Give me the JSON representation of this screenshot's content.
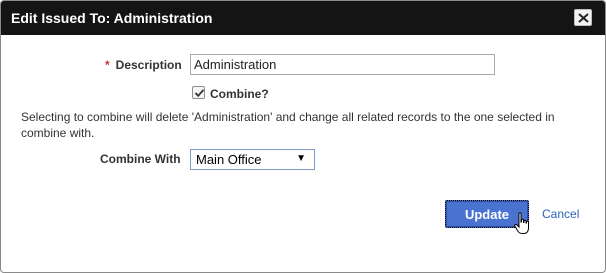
{
  "dialog": {
    "title": "Edit Issued To: Administration",
    "close_icon": "close-icon"
  },
  "form": {
    "description": {
      "required_marker": "*",
      "label": "Description",
      "value": "Administration"
    },
    "combine": {
      "label": "Combine?",
      "checked": true
    },
    "help_text": "Selecting to combine will delete 'Administration' and change all related records to the one selected in combine with.",
    "combine_with": {
      "label": "Combine With",
      "selected": "Main Office"
    }
  },
  "actions": {
    "update_label": "Update",
    "cancel_label": "Cancel"
  },
  "colors": {
    "titlebar": "#141414",
    "primary_button": "#4a72d1",
    "link": "#2a64b8",
    "required": "#c0392b"
  }
}
